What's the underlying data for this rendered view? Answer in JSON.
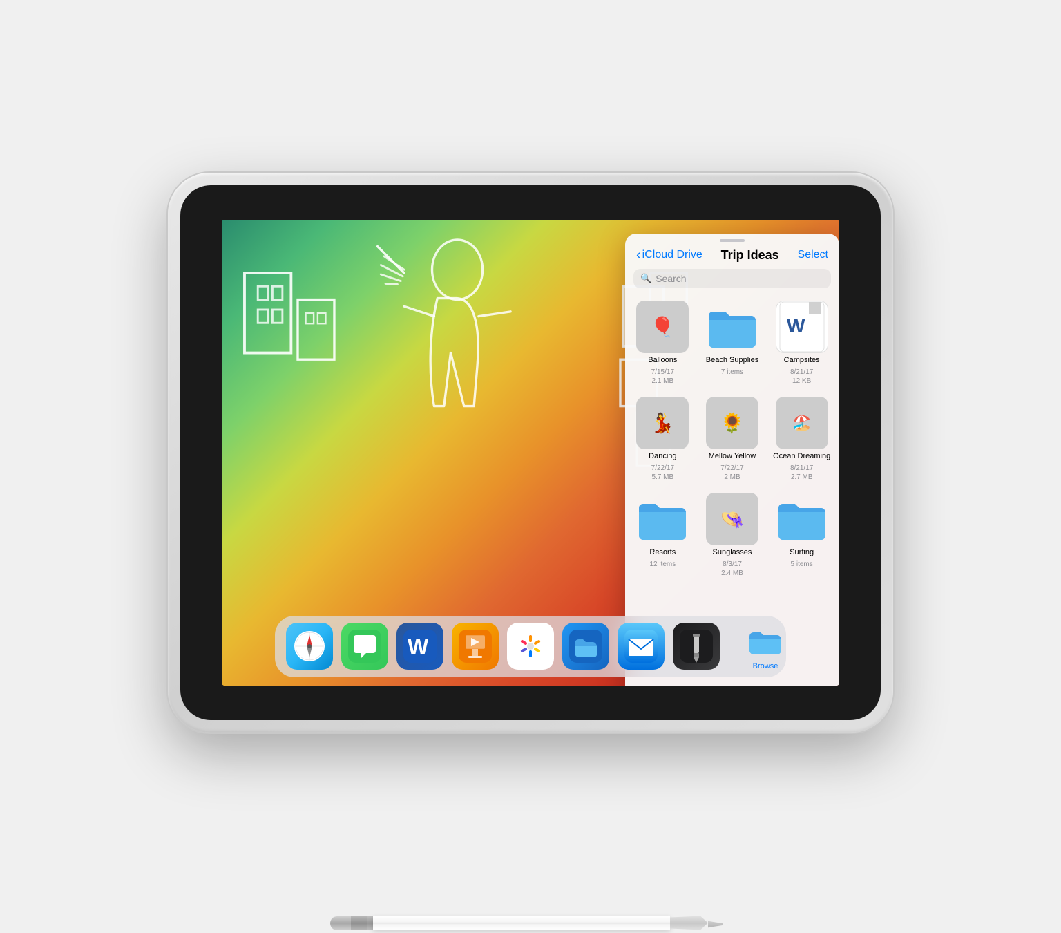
{
  "app": {
    "title": "iPad with Apple Pencil"
  },
  "files_panel": {
    "back_label": "iCloud Drive",
    "title": "Trip Ideas",
    "select_label": "Select",
    "search_placeholder": "Search"
  },
  "files": [
    {
      "name": "Balloons",
      "type": "photo",
      "date": "7/15/17",
      "size": "2.1 MB",
      "thumb": "balloons"
    },
    {
      "name": "Beach Supplies",
      "type": "folder-blue",
      "date": "",
      "size": "7 items",
      "thumb": "folder"
    },
    {
      "name": "Campsites",
      "type": "word-doc",
      "date": "8/21/17",
      "size": "12 KB",
      "thumb": "word"
    },
    {
      "name": "Dancing",
      "type": "photo",
      "date": "7/22/17",
      "size": "5.7 MB",
      "thumb": "dancing"
    },
    {
      "name": "Mellow Yellow",
      "type": "photo",
      "date": "7/22/17",
      "size": "2 MB",
      "thumb": "mellow"
    },
    {
      "name": "Ocean Dreaming",
      "type": "photo",
      "date": "8/21/17",
      "size": "2.7 MB",
      "thumb": "ocean"
    },
    {
      "name": "Resorts",
      "type": "folder-blue",
      "date": "",
      "size": "12 items",
      "thumb": "folder"
    },
    {
      "name": "Sunglasses",
      "type": "photo",
      "date": "8/3/17",
      "size": "2.4 MB",
      "thumb": "sunglasses"
    },
    {
      "name": "Surfing",
      "type": "folder-blue",
      "date": "",
      "size": "5 items",
      "thumb": "folder"
    }
  ],
  "dock": {
    "apps": [
      {
        "name": "Safari",
        "icon": "safari",
        "label": ""
      },
      {
        "name": "Messages",
        "icon": "messages",
        "label": ""
      },
      {
        "name": "Word",
        "icon": "word",
        "label": ""
      },
      {
        "name": "Keynote",
        "icon": "keynote",
        "label": ""
      },
      {
        "name": "Photos",
        "icon": "photos",
        "label": ""
      },
      {
        "name": "Files",
        "icon": "files",
        "label": ""
      },
      {
        "name": "Mail",
        "icon": "mail",
        "label": ""
      },
      {
        "name": "Marker",
        "icon": "marker",
        "label": ""
      }
    ],
    "browse_label": "Browse"
  },
  "colors": {
    "accent": "#007AFF",
    "folder_blue": "#47A5E8",
    "background": "#f0f0f0"
  }
}
